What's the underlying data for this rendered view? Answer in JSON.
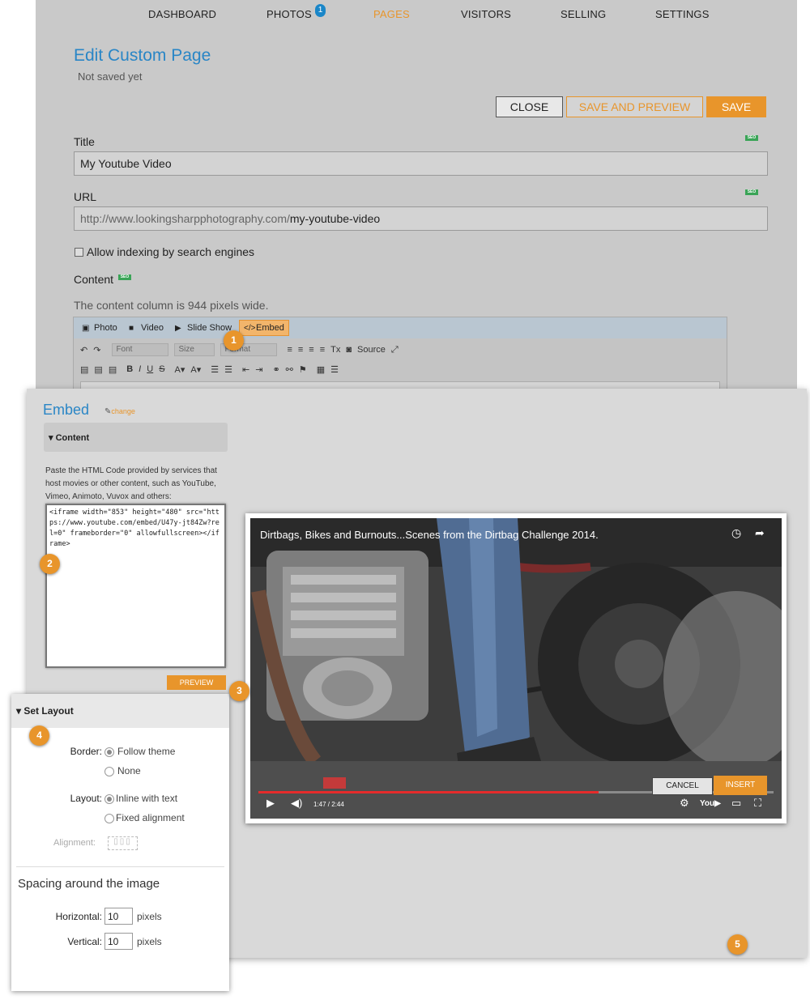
{
  "nav": {
    "items": [
      "DASHBOARD",
      "PHOTOS",
      "PAGES",
      "VISITORS",
      "SELLING",
      "SETTINGS"
    ],
    "active": "PAGES",
    "photos_badge": "1"
  },
  "page": {
    "title": "Edit Custom Page",
    "status": "Not saved yet",
    "buttons": {
      "close": "CLOSE",
      "save_preview": "SAVE AND PREVIEW",
      "save": "SAVE"
    },
    "title_label": "Title",
    "title_value": "My Youtube Video",
    "url_label": "URL",
    "url_prefix": "http://www.lookingsharpphotography.com/",
    "url_slug": "my-youtube-video",
    "indexing_label": "Allow indexing by search engines",
    "content_label": "Content",
    "content_hint": "The content column is 944 pixels wide.",
    "seo_badge": "SEO"
  },
  "editor": {
    "insert": {
      "photo": "Photo",
      "video": "Video",
      "slideshow": "Slide Show",
      "embed": "Embed"
    },
    "font_select": "Font",
    "size_select": "Size",
    "format_select": "Format",
    "source": "Source"
  },
  "embed_dialog": {
    "title": "Embed",
    "change": "change",
    "content_header": "Content",
    "paste_hint": "Paste the HTML Code provided by services that host movies or other content, such as YouTube, Vimeo, Animoto, Vuvox and others:",
    "code": "<iframe width=\"853\" height=\"480\" src=\"https://www.youtube.com/embed/U47y-jt84Zw?rel=0\" frameborder=\"0\" allowfullscreen></iframe>",
    "preview_button": "PREVIEW",
    "cancel_button": "CANCEL",
    "insert_button": "INSERT",
    "video": {
      "title": "Dirtbags, Bikes and Burnouts...Scenes from the Dirtbag Challenge 2014.",
      "time": "1:47 / 2:44",
      "progress": 0.66
    }
  },
  "layout_panel": {
    "header": "Set Layout",
    "border_label": "Border:",
    "border_options": [
      "Follow theme",
      "None"
    ],
    "border_selected": "Follow theme",
    "layout_label": "Layout:",
    "layout_options": [
      "Inline with text",
      "Fixed alignment"
    ],
    "layout_selected": "Inline with text",
    "alignment_label": "Alignment:",
    "spacing_title": "Spacing around the image",
    "horizontal_label": "Horizontal:",
    "horizontal_value": "10",
    "vertical_label": "Vertical:",
    "vertical_value": "10",
    "unit": "pixels"
  },
  "steps": [
    "1",
    "2",
    "3",
    "4",
    "5"
  ],
  "colors": {
    "accent": "#e8952b",
    "link": "#2a86c6",
    "badge": "#1a86c8",
    "seo": "#3aa457"
  }
}
